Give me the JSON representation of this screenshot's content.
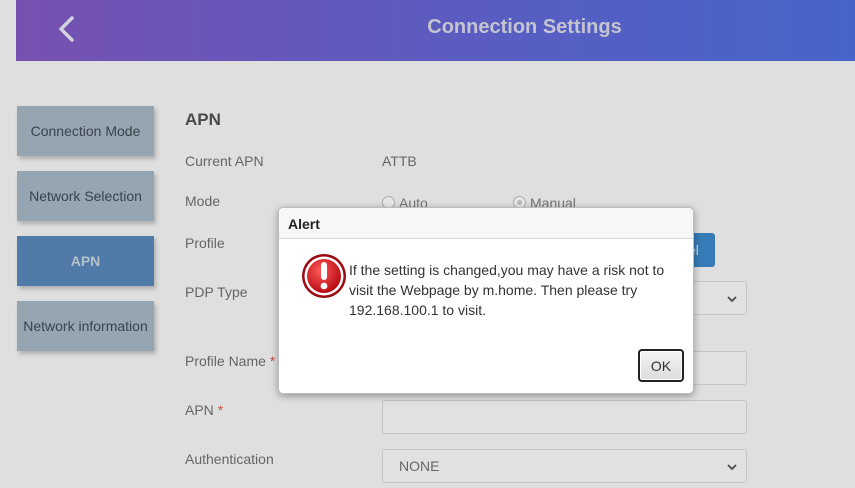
{
  "header": {
    "title": "Connection Settings"
  },
  "sidebar": {
    "items": [
      {
        "label": "Connection Mode"
      },
      {
        "label": "Network Selection"
      },
      {
        "label": "APN"
      },
      {
        "label": "Network information"
      }
    ]
  },
  "main": {
    "section_title": "APN",
    "current_apn_label": "Current APN",
    "current_apn_value": "ATTB",
    "mode_label": "Mode",
    "mode_auto": "Auto",
    "mode_manual": "Manual",
    "profile_label": "Profile",
    "profile_button_fragment": "el",
    "pdp_type_label": "PDP Type",
    "profile_name_label": "Profile Name",
    "apn_label": "APN",
    "required_mark": "*",
    "authentication_label": "Authentication",
    "authentication_value": "NONE"
  },
  "dialog": {
    "title": "Alert",
    "message": "If the setting is changed,you may have a risk not to visit the Webpage by m.home. Then please try 192.168.100.1 to visit.",
    "ok_label": "OK"
  },
  "colors": {
    "header_start": "#6a3cb0",
    "header_end": "#2f55d0",
    "active_tab": "#3b6fa6",
    "alert_red": "#d4141c"
  }
}
